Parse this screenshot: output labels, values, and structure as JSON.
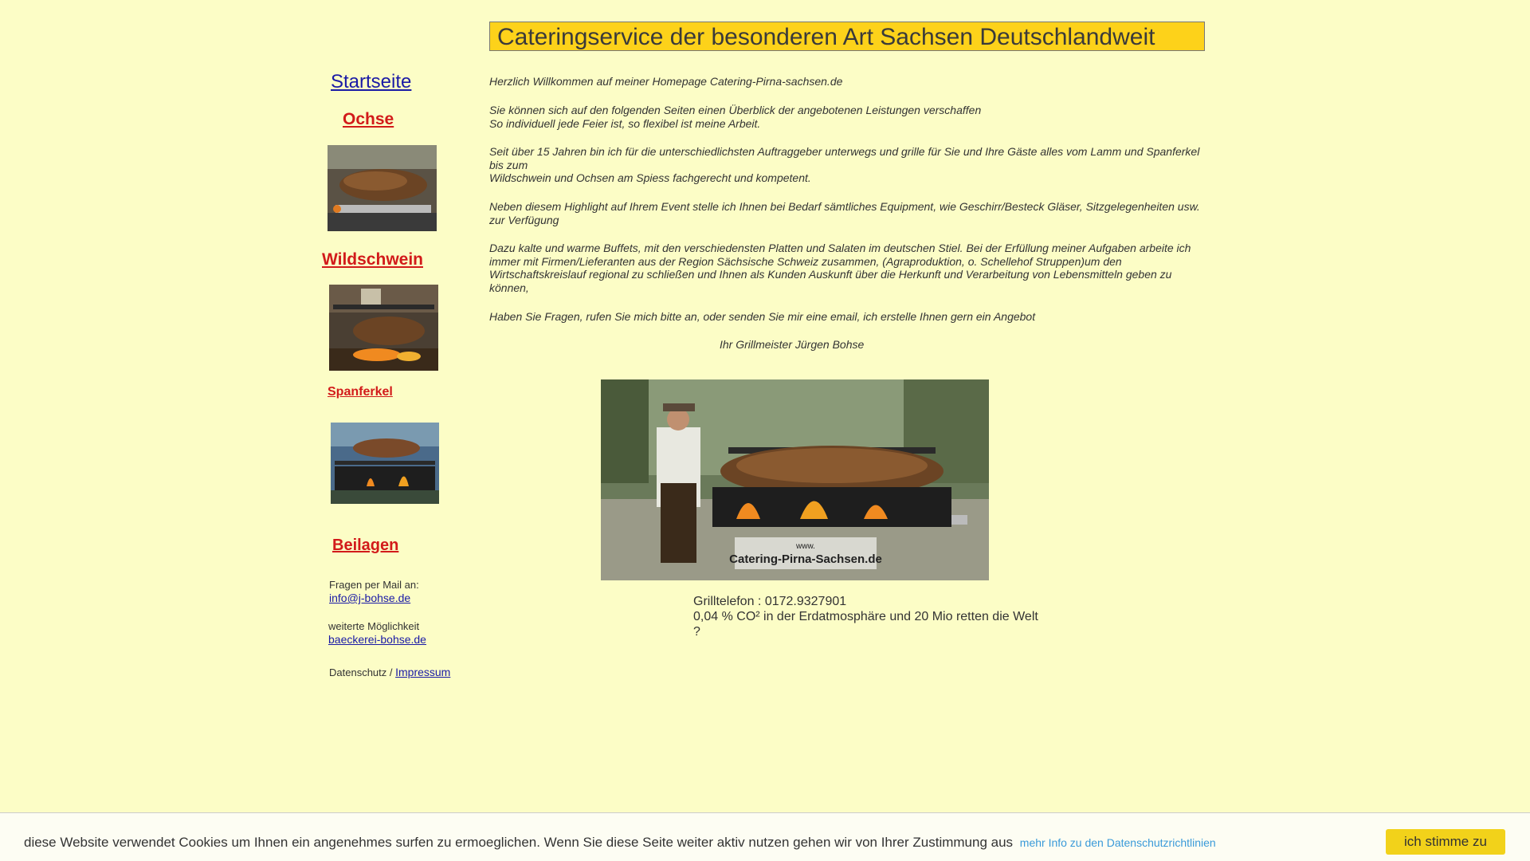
{
  "sidebar": {
    "startseite": "Startseite",
    "ochse": "Ochse",
    "wildschwein": "Wildschwein",
    "spanferkel": "Spanferkel",
    "beilagen": "Beilagen",
    "mail_label": "Fragen per Mail an:",
    "mail_link": "info@j-bohse.de",
    "more_label": "weiterte Möglichkeit",
    "more_link": "baeckerei-bohse.de",
    "datenschutz": "Datenschutz / ",
    "impressum": "Impressum"
  },
  "header": {
    "title": "Cateringservice der besonderen Art Sachsen Deutschlandweit"
  },
  "main": {
    "welcome": "Herzlich Willkommen auf meiner Homepage  Catering-Pirna-sachsen.de",
    "p1_l1": "Sie können sich auf den folgenden Seiten einen Überblick der angebotenen Leistungen verschaffen",
    "p1_l2": "So individuell jede Feier ist, so flexibel ist meine Arbeit.",
    "p2_l1": "Seit über 15 Jahren bin ich für die unterschiedlichsten Auftraggeber unterwegs und grille für Sie und Ihre Gäste alles vom Lamm und Spanferkel bis zum",
    "p2_l2": "Wildschwein und Ochsen am Spiess fachgerecht und kompetent.",
    "p3": "Neben diesem Highlight auf Ihrem Event stelle ich Ihnen bei Bedarf sämtliches Equipment, wie Geschirr/Besteck Gläser, Sitzgelegenheiten usw. zur Verfügung",
    "p4": "Dazu kalte und warme Buffets, mit den verschiedensten Platten und Salaten im deutschen Stiel. Bei der Erfüllung meiner Aufgaben arbeite ich immer mit Firmen/Lieferanten aus der Region Sächsische Schweiz zusammen, (Agraproduktion, o. Schellehof Struppen)um den Wirtschaftskreislauf regional zu schließen und Ihnen als Kunden Auskunft über die Herkunft und Verarbeitung von Lebensmitteln geben zu können,",
    "p5": "Haben Sie Fragen, rufen Sie mich bitte an, oder senden Sie mir eine email, ich erstelle Ihnen gern ein Angebot",
    "signature": "Ihr Grillmeister  Jürgen Bohse",
    "photo_sign_l1": "www.",
    "photo_sign_l2": "Catering-Pirna-Sachsen.de",
    "phone": "Grilltelefon : 0172.9327901",
    "co2": "0,04 % CO² in der Erdatmosphäre und 20 Mio retten die Welt",
    "question": "?"
  },
  "cookie": {
    "text": "diese Website verwendet Cookies um Ihnen ein angenehmes surfen zu ermoeglichen. Wenn Sie diese Seite weiter aktiv nutzen gehen wir von Ihrer Zustimmung aus",
    "link": "mehr Info zu den Datenschutzrichtlinien",
    "button": "ich stimme zu"
  },
  "colors": {
    "background": "#fcfdc6",
    "header_bg": "#fdd21a",
    "nav_red": "#d21a1a",
    "link_blue": "#1a1aa6",
    "cookie_button": "#f2d21a"
  }
}
